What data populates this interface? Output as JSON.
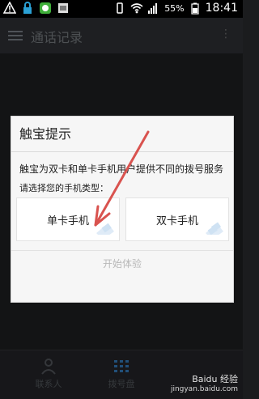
{
  "status_bar": {
    "battery_percent": "55%",
    "time": "18:41"
  },
  "app_bar": {
    "title": "通话记录"
  },
  "dialog": {
    "title": "触宝提示",
    "description": "触宝为双卡和单卡手机用户提供不同的拨号服务",
    "prompt": "请选择您的手机类型：",
    "options": [
      "单卡手机",
      "双卡手机"
    ],
    "start_button": "开始体验"
  },
  "bottom_tabs": [
    {
      "label": "联系人"
    },
    {
      "label": "拨号盘"
    }
  ],
  "watermark": {
    "brand": "Baidu 经验",
    "site": "jingyan.baidu.com"
  },
  "colors": {
    "arrow": "#d9534f",
    "accent_bar": "#2f6ea8"
  }
}
